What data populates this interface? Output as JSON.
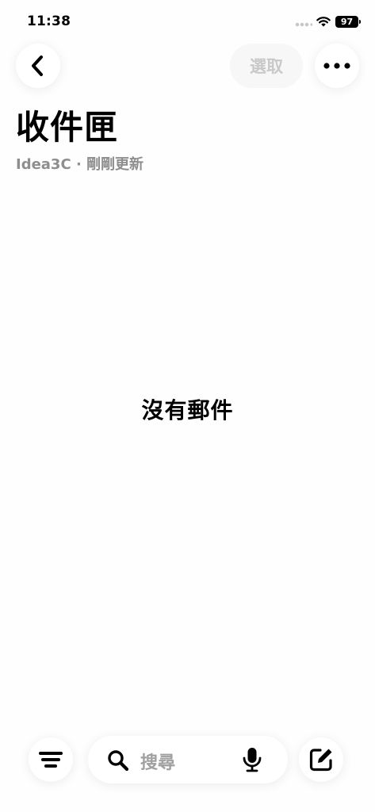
{
  "status_bar": {
    "time": "11:38",
    "battery": "97"
  },
  "header": {
    "select_label": "選取"
  },
  "page": {
    "title": "收件匣",
    "subtitle": "Idea3C · 剛剛更新"
  },
  "empty_state": {
    "message": "沒有郵件"
  },
  "search": {
    "placeholder": "搜尋"
  },
  "icons": {
    "back": "chevron-left-icon",
    "more": "ellipsis-icon",
    "filter": "filter-lines-icon",
    "search": "magnifier-icon",
    "mic": "microphone-icon",
    "compose": "compose-icon",
    "wifi": "wifi-icon",
    "signal": "signal-dots-icon",
    "battery": "battery-icon"
  }
}
